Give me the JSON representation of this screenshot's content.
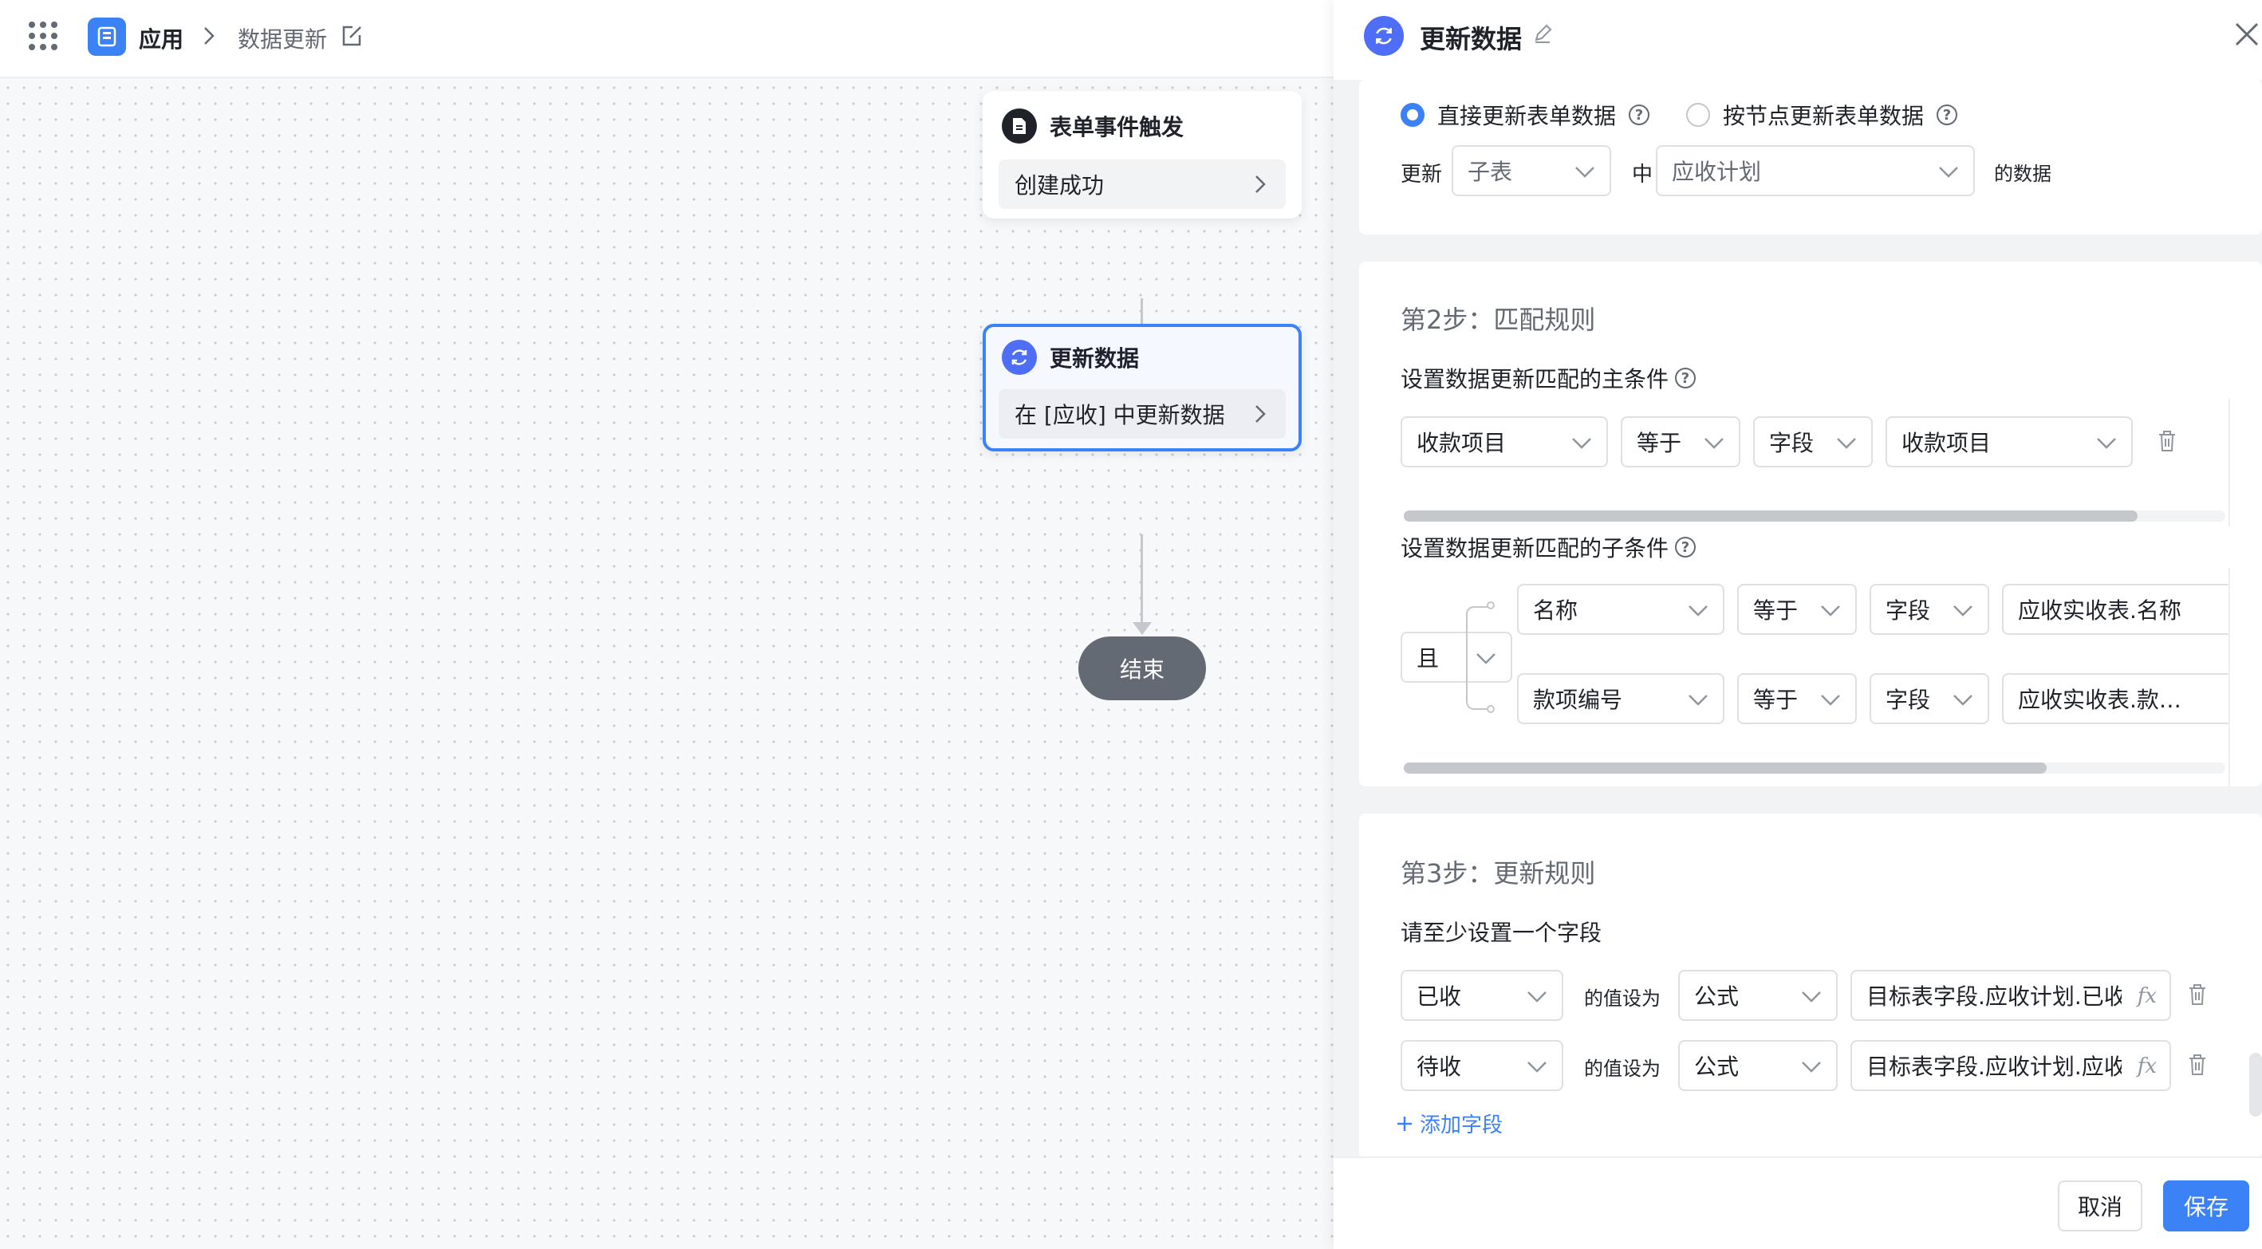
{
  "header": {
    "app_label": "应用",
    "page_label": "数据更新"
  },
  "flow": {
    "trigger": {
      "title": "表单事件触发",
      "body": "创建成功"
    },
    "update": {
      "title": "更新数据",
      "body": "在 [应收] 中更新数据"
    },
    "end": {
      "label": "结束"
    }
  },
  "panel": {
    "title": "更新数据",
    "step1": {
      "radio_direct": "直接更新表单数据",
      "radio_node": "按节点更新表单数据",
      "update_label": "更新",
      "target_type": "子表",
      "in_label": "中",
      "target_table": "应收计划",
      "data_suffix": "的数据"
    },
    "step2": {
      "title": "第2步：匹配规则",
      "main_label": "设置数据更新匹配的主条件",
      "main_rule": {
        "field": "收款项目",
        "op": "等于",
        "type": "字段",
        "value": "收款项目"
      },
      "sub_label": "设置数据更新匹配的子条件",
      "logic": "且",
      "sub_rules": [
        {
          "field": "名称",
          "op": "等于",
          "type": "字段",
          "value": "应收实收表.名称"
        },
        {
          "field": "款项编号",
          "op": "等于",
          "type": "字段",
          "value": "应收实收表.款…"
        }
      ]
    },
    "step3": {
      "title": "第3步：更新规则",
      "hint": "请至少设置一个字段",
      "set_label": "的值设为",
      "rules": [
        {
          "field": "已收",
          "mode": "公式",
          "formula": "目标表字段.应收计划.已收"
        },
        {
          "field": "待收",
          "mode": "公式",
          "formula": "目标表字段.应收计划.应收"
        }
      ],
      "add_field": "添加字段"
    }
  },
  "footer": {
    "cancel": "取消",
    "save": "保存"
  },
  "colors": {
    "primary": "#3b82f6",
    "node_icon": "#4f6ef7",
    "end": "#646a73"
  }
}
